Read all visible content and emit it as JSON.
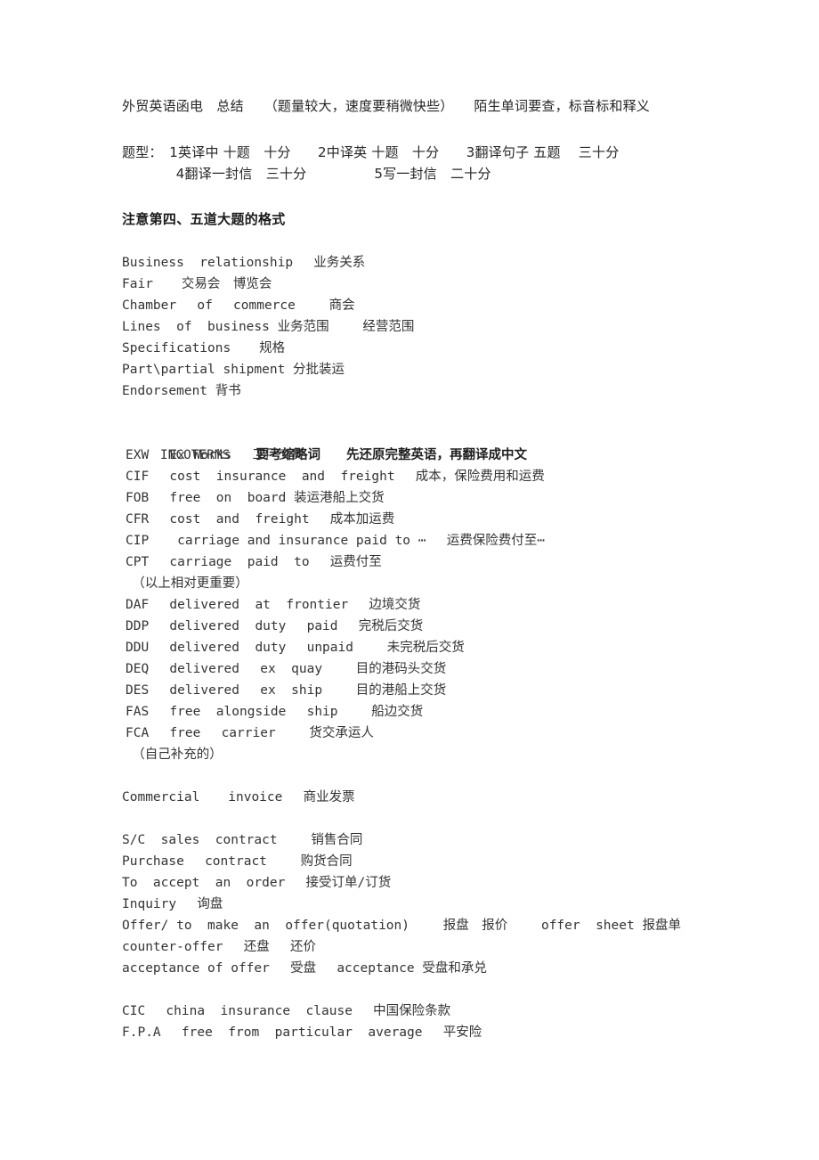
{
  "document": {
    "language": "zh-CN",
    "background_color": "#ffffff",
    "text_color": "#333333",
    "header": {
      "title_line": "外贸英语函电　总结　　（题量较大，速度要稍微快些）　　陌生单词要查，标音标和释义",
      "exam_format_line_1": "题型：　1英译中 十题　十分　　2中译英 十题　十分　　3翻译句子 五题　 三十分",
      "exam_format_line_2": "　　　　4翻译一封信　三十分　　　　　5写一封信　二十分",
      "notice_heading": "注意第四、五道大题的格式"
    },
    "sections": [
      {
        "name": "general-terms",
        "lines": [
          "Business  relationship 　业务关系",
          "Fair 　 交易会　博览会",
          "Chamber 　of 　commerce 　　商会",
          "Lines  of  business 业务范围 　　经营范围",
          "Specifications 　 规格",
          "Part\\partial shipment 分批装运",
          "Endorsement 背书"
        ]
      },
      {
        "name": "incoterms",
        "title_line": "INCOTERMS 　 要考缩略词 　 先还原完整英语，再翻译成中文",
        "title_en": "INCOTERMS",
        "title_note_1": "要考缩略词",
        "title_note_2": "先还原完整英语，再翻译成中文",
        "lines": [
          "EXW 　Ex Works 　工厂交货",
          "CIF 　cost  insurance  and  freight 　成本，保险费用和运费",
          "FOB 　free  on  board 装运港船上交货",
          "CFR 　cost  and  freight 　成本加运费",
          "CIP 　 carriage and insurance paid to ⋯ 　运费保险费付至⋯",
          "CPT 　carriage  paid  to 　运费付至",
          "　（以上相对更重要）",
          "DAF 　delivered  at  frontier 　边境交货",
          "DDP 　delivered  duty 　paid 　完税后交货",
          "DDU 　delivered  duty 　unpaid 　　未完税后交货",
          "DEQ 　delivered 　ex  quay 　　目的港码头交货",
          "DES 　delivered 　ex  ship 　　目的港船上交货",
          "FAS 　free  alongside 　ship 　　船边交货",
          "FCA 　free 　carrier 　　货交承运人",
          "　（自己补充的）"
        ]
      },
      {
        "name": "invoice",
        "lines": [
          "Commercial 　 invoice 　商业发票"
        ]
      },
      {
        "name": "contracts-and-offers",
        "lines": [
          "S/C  sales  contract 　　销售合同",
          "Purchase 　contract 　　购货合同",
          "To  accept  an  order 　接受订单/订货",
          "Inquiry 　询盘",
          "Offer/ to  make  an  offer(quotation) 　　报盘　报价 　　offer  sheet 报盘单",
          "counter-offer 　还盘 　还价",
          "acceptance of offer 　受盘 　acceptance 受盘和承兑"
        ]
      },
      {
        "name": "insurance",
        "lines": [
          "CIC 　china  insurance  clause 　中国保险条款",
          "F.P.A 　free  from  particular  average 　平安险"
        ]
      }
    ]
  }
}
